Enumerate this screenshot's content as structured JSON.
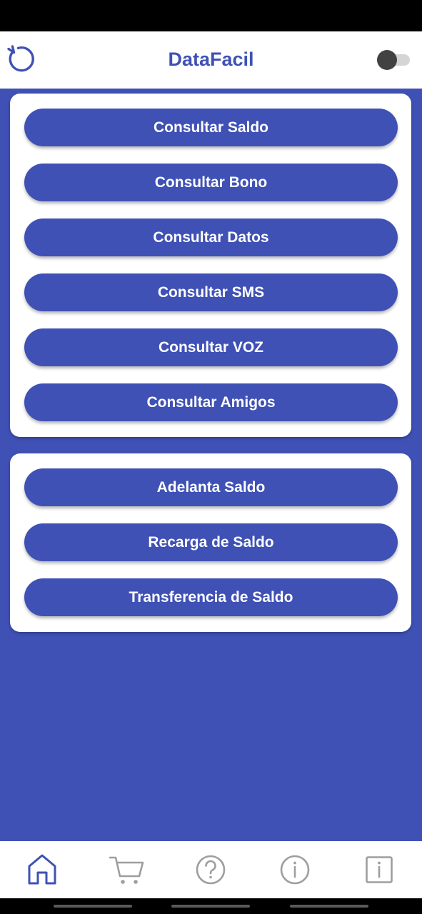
{
  "header": {
    "title": "DataFacil",
    "refresh_icon": "refresh-icon",
    "theme_toggle_on": false
  },
  "colors": {
    "primary": "#3f51b5",
    "background": "#3f51b5",
    "card": "#ffffff",
    "nav_inactive": "#9e9e9e"
  },
  "consultas": {
    "buttons": [
      {
        "label": "Consultar Saldo"
      },
      {
        "label": "Consultar Bono"
      },
      {
        "label": "Consultar Datos"
      },
      {
        "label": "Consultar SMS"
      },
      {
        "label": "Consultar VOZ"
      },
      {
        "label": "Consultar Amigos"
      }
    ]
  },
  "saldo": {
    "buttons": [
      {
        "label": "Adelanta Saldo"
      },
      {
        "label": "Recarga de Saldo"
      },
      {
        "label": "Transferencia de Saldo"
      }
    ]
  },
  "bottom_nav": {
    "items": [
      {
        "icon": "home-icon",
        "active": true
      },
      {
        "icon": "cart-icon",
        "active": false
      },
      {
        "icon": "help-circle-icon",
        "active": false
      },
      {
        "icon": "info-circle-icon",
        "active": false
      },
      {
        "icon": "info-square-icon",
        "active": false
      }
    ]
  }
}
